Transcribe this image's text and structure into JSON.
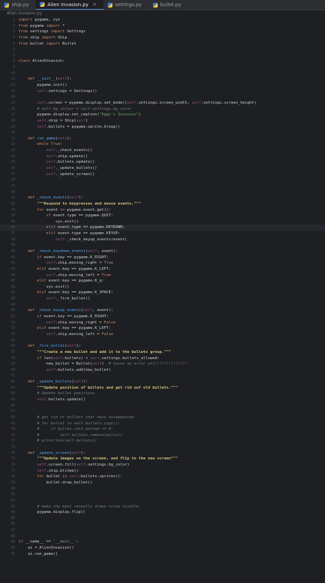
{
  "tabs": [
    {
      "label": "ship.py",
      "active": false
    },
    {
      "label": "Alien Invasion.py",
      "active": true
    },
    {
      "label": "settings.py",
      "active": false
    },
    {
      "label": "bullet.py",
      "active": false
    }
  ],
  "breadcrumb": "Alien Invasion.py",
  "colors": {
    "keyword": "#cf8e6d",
    "self": "#94558d",
    "function": "#56a8f5",
    "string": "#6aab73",
    "docstring": "#d0c27f",
    "comment": "#7a7e85"
  },
  "lines": [
    [
      [
        "kw",
        "import "
      ],
      [
        "t",
        "pygame, sys"
      ]
    ],
    [
      [
        "kw",
        "from "
      ],
      [
        "t",
        "pygame "
      ],
      [
        "kw",
        "import "
      ],
      [
        "t",
        "*"
      ]
    ],
    [
      [
        "kw",
        "from "
      ],
      [
        "t",
        "settings "
      ],
      [
        "kw",
        "import "
      ],
      [
        "t",
        "Settings"
      ]
    ],
    [
      [
        "kw",
        "from "
      ],
      [
        "t",
        "ship "
      ],
      [
        "kw",
        "import "
      ],
      [
        "t",
        "Ship"
      ]
    ],
    [
      [
        "kw",
        "from "
      ],
      [
        "t",
        "bullet "
      ],
      [
        "kw",
        "import "
      ],
      [
        "t",
        "Bullet"
      ]
    ],
    [],
    [],
    [
      [
        "kw",
        "class "
      ],
      [
        "t",
        "AlienInvasion:"
      ]
    ],
    [],
    [],
    [
      [
        "t",
        "    "
      ],
      [
        "kw",
        "def "
      ],
      [
        "dunder",
        "__init__"
      ],
      [
        "t",
        "("
      ],
      [
        "slf",
        "self"
      ],
      [
        "t",
        "):"
      ]
    ],
    [
      [
        "t",
        "        pygame.init()"
      ]
    ],
    [
      [
        "t",
        "        "
      ],
      [
        "slf",
        "self"
      ],
      [
        "t",
        ".settings = Settings()"
      ]
    ],
    [],
    [
      [
        "t",
        "        "
      ],
      [
        "slf",
        "self"
      ],
      [
        "t",
        ".screen = pygame.display.set_mode(("
      ],
      [
        "slf",
        "self"
      ],
      [
        "t",
        ".settings.screen_width, "
      ],
      [
        "slf",
        "self"
      ],
      [
        "t",
        ".settings.screen_height)"
      ]
    ],
    [
      [
        "cmt",
        "        # self.bg_colour = self.settings.bg_color"
      ]
    ],
    [
      [
        "t",
        "        pygame.display.set_caption("
      ],
      [
        "str",
        "\"Eggy's Invasion\""
      ],
      [
        "t",
        ")"
      ]
    ],
    [
      [
        "t",
        "        "
      ],
      [
        "slf",
        "self"
      ],
      [
        "t",
        ".ship = Ship("
      ],
      [
        "slf",
        "self"
      ],
      [
        "t",
        ")"
      ]
    ],
    [
      [
        "t",
        "        "
      ],
      [
        "slf",
        "self"
      ],
      [
        "t",
        ".bullets = pygame.sprite.Group()"
      ]
    ],
    [],
    [
      [
        "t",
        "    "
      ],
      [
        "kw",
        "def "
      ],
      [
        "fn",
        "run_game"
      ],
      [
        "t",
        "("
      ],
      [
        "slf",
        "self"
      ],
      [
        "t",
        "):"
      ]
    ],
    [
      [
        "t",
        "        "
      ],
      [
        "kw",
        "while True"
      ],
      [
        "t",
        ":"
      ]
    ],
    [
      [
        "t",
        "            "
      ],
      [
        "slf",
        "self"
      ],
      [
        "t",
        "._check_events()"
      ]
    ],
    [
      [
        "t",
        "            "
      ],
      [
        "slf",
        "self"
      ],
      [
        "t",
        ".ship.update()"
      ]
    ],
    [
      [
        "t",
        "            "
      ],
      [
        "slf",
        "self"
      ],
      [
        "t",
        ".bullets.update()"
      ]
    ],
    [
      [
        "t",
        "            "
      ],
      [
        "slf",
        "self"
      ],
      [
        "t",
        "._update_bullets()"
      ]
    ],
    [
      [
        "t",
        "            "
      ],
      [
        "slf",
        "self"
      ],
      [
        "t",
        "._update_screen()"
      ]
    ],
    [],
    [],
    [],
    [
      [
        "t",
        "    "
      ],
      [
        "kw",
        "def "
      ],
      [
        "fn",
        "_check_events"
      ],
      [
        "t",
        "("
      ],
      [
        "slf",
        "self"
      ],
      [
        "t",
        "):"
      ]
    ],
    [
      [
        "t",
        "        "
      ],
      [
        "doc",
        "\"\"\"Respond to keypresses and mouse events.\"\"\""
      ]
    ],
    [
      [
        "t",
        "        "
      ],
      [
        "kw",
        "for "
      ],
      [
        "t",
        "event "
      ],
      [
        "kw",
        "in "
      ],
      [
        "t",
        "pygame.event.get():"
      ]
    ],
    [
      [
        "t",
        "            "
      ],
      [
        "kw",
        "if "
      ],
      [
        "t",
        "event.type == pygame.QUIT:"
      ]
    ],
    [
      [
        "t",
        "                sys.exit()"
      ]
    ],
    [
      [
        "t",
        "            "
      ],
      [
        "kw",
        "elif "
      ],
      [
        "t",
        "event.type == pygame.KEYDOWN:"
      ]
    ],
    [
      [
        "t",
        "            "
      ],
      [
        "kw",
        "elif "
      ],
      [
        "t",
        "event.type == pygame.KEYUP:"
      ]
    ],
    [
      [
        "t",
        "                "
      ],
      [
        "slf",
        "self"
      ],
      [
        "t",
        "._check_keyup_events(event)"
      ]
    ],
    [],
    [
      [
        "t",
        "    "
      ],
      [
        "kw",
        "def "
      ],
      [
        "fn",
        "_check_keydown_events"
      ],
      [
        "t",
        "("
      ],
      [
        "slf",
        "self"
      ],
      [
        "t",
        ", event):"
      ]
    ],
    [
      [
        "t",
        "        "
      ],
      [
        "kw",
        "if "
      ],
      [
        "t",
        "event.key == pygame.K_RIGHT:"
      ]
    ],
    [
      [
        "t",
        "            "
      ],
      [
        "slf",
        "self"
      ],
      [
        "t",
        ".ship.moving_right = "
      ],
      [
        "kw",
        "True"
      ]
    ],
    [
      [
        "t",
        "        "
      ],
      [
        "kw",
        "elif "
      ],
      [
        "t",
        "event.key == pygame.K_LEFT:"
      ]
    ],
    [
      [
        "t",
        "            "
      ],
      [
        "slf",
        "self"
      ],
      [
        "t",
        ".ship.moving_left = "
      ],
      [
        "kw",
        "True"
      ]
    ],
    [
      [
        "t",
        "        "
      ],
      [
        "kw",
        "elif "
      ],
      [
        "t",
        "event.key == pygame.K_q:"
      ]
    ],
    [
      [
        "t",
        "            sys.exit()"
      ]
    ],
    [
      [
        "t",
        "        "
      ],
      [
        "kw",
        "elif "
      ],
      [
        "t",
        "event.key == pygame.K_SPACE:"
      ]
    ],
    [
      [
        "t",
        "            "
      ],
      [
        "slf",
        "self"
      ],
      [
        "t",
        "._fire_bullet()"
      ]
    ],
    [],
    [
      [
        "t",
        "    "
      ],
      [
        "kw",
        "def "
      ],
      [
        "fn",
        "_check_keyup_events"
      ],
      [
        "t",
        "("
      ],
      [
        "slf",
        "self"
      ],
      [
        "t",
        ", event):"
      ]
    ],
    [
      [
        "t",
        "        "
      ],
      [
        "kw",
        "if "
      ],
      [
        "t",
        "event.key == pygame.K_RIGHT:"
      ]
    ],
    [
      [
        "t",
        "            "
      ],
      [
        "slf",
        "self"
      ],
      [
        "t",
        ".ship.moving_right = "
      ],
      [
        "kw",
        "False"
      ]
    ],
    [
      [
        "t",
        "        "
      ],
      [
        "kw",
        "elif "
      ],
      [
        "t",
        "event.key == pygame.K_LEFT:"
      ]
    ],
    [
      [
        "t",
        "            "
      ],
      [
        "slf",
        "self"
      ],
      [
        "t",
        ".ship.moving_left = "
      ],
      [
        "kw",
        "False"
      ]
    ],
    [],
    [
      [
        "t",
        "    "
      ],
      [
        "kw",
        "def "
      ],
      [
        "fn",
        "_fire_bullet"
      ],
      [
        "t",
        "("
      ],
      [
        "slf",
        "self"
      ],
      [
        "t",
        "):"
      ]
    ],
    [
      [
        "t",
        "        "
      ],
      [
        "doc",
        "\"\"\"Create a new bullet and add it to the bullets group.\"\"\""
      ]
    ],
    [
      [
        "t",
        "        "
      ],
      [
        "kw",
        "if "
      ],
      [
        "t",
        "len("
      ],
      [
        "slf",
        "self"
      ],
      [
        "t",
        ".bullets) < "
      ],
      [
        "slf",
        "self"
      ],
      [
        "t",
        ".settings.bullets_allowed:"
      ]
    ],
    [
      [
        "t",
        "            new_bullet = Bullet("
      ],
      [
        "slf",
        "self"
      ],
      [
        "t",
        ")  "
      ],
      [
        "cmt",
        "# haves an error wtf!!!!!!!!!!!!!!"
      ]
    ],
    [
      [
        "t",
        "            "
      ],
      [
        "slf",
        "self"
      ],
      [
        "t",
        ".bullets.add(new_bullet)"
      ]
    ],
    [],
    [
      [
        "t",
        "    "
      ],
      [
        "kw",
        "def "
      ],
      [
        "fn",
        "_update_bullets"
      ],
      [
        "t",
        "("
      ],
      [
        "slf",
        "self"
      ],
      [
        "t",
        "):"
      ]
    ],
    [
      [
        "t",
        "        "
      ],
      [
        "doc",
        "\"\"\"Update position of bullets and get rid oof old bullets.\"\"\""
      ]
    ],
    [
      [
        "cmt",
        "        # Update bullet positions."
      ]
    ],
    [
      [
        "t",
        "        "
      ],
      [
        "slf",
        "self"
      ],
      [
        "t",
        ".bullets.update()"
      ]
    ],
    [],
    [],
    [
      [
        "cmt",
        "        # get rid of bullets that have disappeared"
      ]
    ],
    [
      [
        "cmt",
        "        # for bullet in self.bullets.copy():"
      ]
    ],
    [
      [
        "cmt",
        "        #     if bullet.rect.bottom <= 0:"
      ]
    ],
    [
      [
        "cmt",
        "        #         self.bullets.remove(bullet)"
      ]
    ],
    [
      [
        "cmt",
        "        # print(len(self.bullets))"
      ]
    ],
    [],
    [
      [
        "t",
        "    "
      ],
      [
        "kw",
        "def "
      ],
      [
        "fn",
        "_update_screen"
      ],
      [
        "t",
        "("
      ],
      [
        "slf",
        "self"
      ],
      [
        "t",
        "):"
      ]
    ],
    [
      [
        "t",
        "        "
      ],
      [
        "doc",
        "\"\"\"Update images on the screen, and flip to the new screen\"\"\""
      ]
    ],
    [
      [
        "t",
        "        "
      ],
      [
        "slf",
        "self"
      ],
      [
        "t",
        ".screen.fill("
      ],
      [
        "slf",
        "self"
      ],
      [
        "t",
        ".settings.bg_color)"
      ]
    ],
    [
      [
        "t",
        "        "
      ],
      [
        "slf",
        "self"
      ],
      [
        "t",
        ".ship.blitme()"
      ]
    ],
    [
      [
        "t",
        "        "
      ],
      [
        "kw",
        "for "
      ],
      [
        "t",
        "bullet "
      ],
      [
        "kw",
        "in "
      ],
      [
        "slf",
        "self"
      ],
      [
        "t",
        ".bullets.sprites():"
      ]
    ],
    [
      [
        "t",
        "            bullet.draw_bullet()"
      ]
    ],
    [],
    [],
    [],
    [
      [
        "cmt",
        "        # make the most recently drawn scree visible"
      ]
    ],
    [
      [
        "t",
        "        pygame.display.flip()"
      ]
    ],
    [],
    [],
    [],
    [],
    [
      [
        "kw",
        "if "
      ],
      [
        "t",
        "__name__ == "
      ],
      [
        "str",
        "'__main__'"
      ],
      [
        "t",
        ":"
      ]
    ],
    [
      [
        "t",
        "    ai = AlienInvasion()"
      ]
    ],
    [
      [
        "t",
        "    ai.run_game()"
      ]
    ]
  ]
}
